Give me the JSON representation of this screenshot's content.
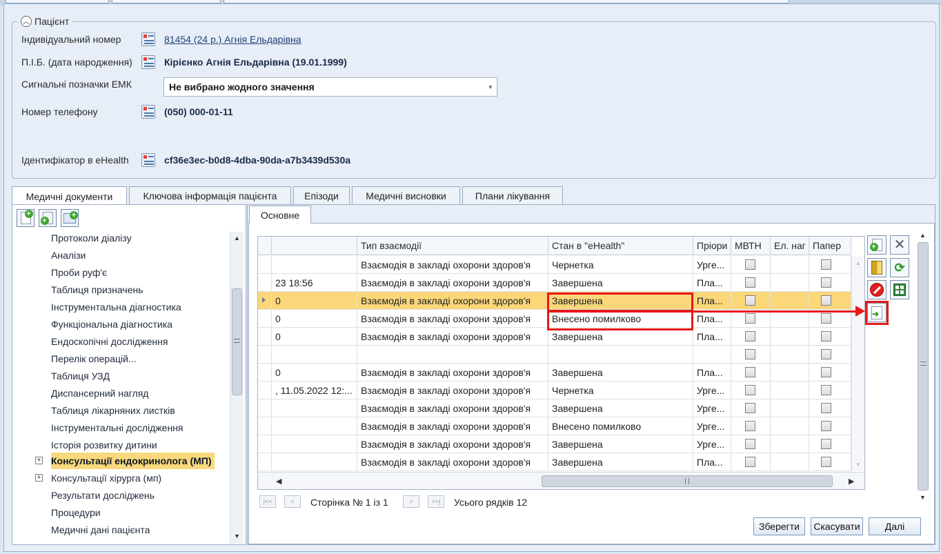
{
  "patient": {
    "section_title": "Пацієнт",
    "id_label": "Індивідуальний номер",
    "id_value": "81454 (24 р.) Агнія Ельдарівна",
    "name_label": "П.І.Б. (дата народження)",
    "name_value": "Кірієнко Агнія Ельдарівна (19.01.1999)",
    "signal_label": "Сигнальні позначки ЕМК",
    "signal_value": "Не вибрано жодного значення",
    "phone_label": "Номер телефону",
    "phone_value": "(050) 000-01-11",
    "ehealth_label": "Ідентифікатор в eHealth",
    "ehealth_value": "cf36e3ec-b0d8-4dba-90da-a7b3439d530a"
  },
  "tabs": [
    "Медичні документи",
    "Ключова інформація пацієнта",
    "Епізоди",
    "Медичні висновки",
    "Плани лікування"
  ],
  "subtab": "Основне",
  "tree": {
    "items": [
      "Протоколи діалізу",
      "Аналізи",
      "Проби руф'є",
      "Таблиця призначень",
      "Інструментальна діагностика",
      "Функціональна діагностика",
      "Ендоскопічні дослідження",
      "Перелік операцій...",
      "Таблиця УЗД",
      "Диспансерний нагляд",
      "Таблиця лікарняних листків",
      "Інструментальні дослідження",
      "Історія розвитку дитини",
      "Консультації ендокринолога (МП)",
      "Консультації хірурга (мп)",
      "Результати досліджень",
      "Процедури",
      "Медичні дані пацієнта"
    ],
    "selected": "Консультації ендокринолога (МП)"
  },
  "grid": {
    "headers": [
      "Тип взаємодії",
      "Стан в \"eHealth\"",
      "Пріори",
      "МВТН",
      "Ел. наг",
      "Папер"
    ],
    "rows": [
      {
        "c0": "",
        "type": "Взаємодія в закладі охорони здоров'я",
        "state": "Чернетка",
        "prio": "Урге..."
      },
      {
        "c0": "23 18:56",
        "type": "Взаємодія в закладі охорони здоров'я",
        "state": "Завершена",
        "prio": "Пла..."
      },
      {
        "c0": "0",
        "type": "Взаємодія в закладі охорони здоров'я",
        "state": "Завершена",
        "prio": "Пла..."
      },
      {
        "c0": "0",
        "type": "Взаємодія в закладі охорони здоров'я",
        "state": "Внесено помилково",
        "prio": "Пла..."
      },
      {
        "c0": "0",
        "type": "Взаємодія в закладі охорони здоров'я",
        "state": "Завершена",
        "prio": "Пла..."
      },
      {
        "c0": "",
        "type": "",
        "state": "",
        "prio": ""
      },
      {
        "c0": "0",
        "type": "Взаємодія в закладі охорони здоров'я",
        "state": "Завершена",
        "prio": "Пла..."
      },
      {
        "c0": ", 11.05.2022 12:...",
        "type": "Взаємодія в закладі охорони здоров'я",
        "state": "Чернетка",
        "prio": "Урге..."
      },
      {
        "c0": "",
        "type": "Взаємодія в закладі охорони здоров'я",
        "state": "Завершена",
        "prio": "Урге..."
      },
      {
        "c0": "",
        "type": "Взаємодія в закладі охорони здоров'я",
        "state": "Внесено помилково",
        "prio": "Урге..."
      },
      {
        "c0": "",
        "type": "Взаємодія в закладі охорони здоров'я",
        "state": "Завершена",
        "prio": "Урге..."
      },
      {
        "c0": "",
        "type": "Взаємодія в закладі охорони здоров'я",
        "state": "Завершена",
        "prio": "Пла..."
      }
    ]
  },
  "pager": {
    "page_text": "Сторінка № 1 із 1",
    "rows_text": "Усього рядків 12"
  },
  "buttons": {
    "save": "Зберегти",
    "cancel": "Скасувати",
    "next": "Далі"
  },
  "colors": {
    "highlight": "#fbd77a",
    "annotation": "#e81818",
    "accent": "#1f3f78"
  }
}
